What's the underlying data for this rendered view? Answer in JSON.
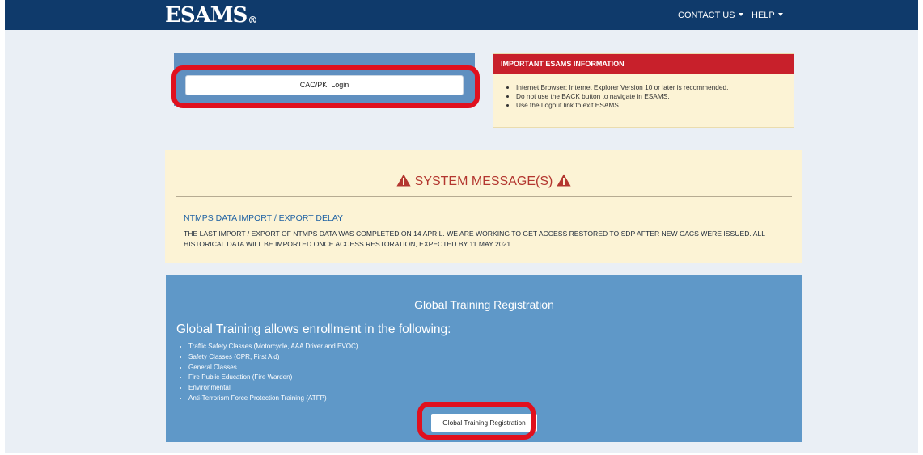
{
  "nav": {
    "logo": "ESAMS",
    "logo_mark": "®",
    "contact": "CONTACT US",
    "help": "HELP"
  },
  "login": {
    "button_label": "CAC/PKI Login"
  },
  "info": {
    "heading": "IMPORTANT ESAMS INFORMATION",
    "items": [
      "Internet Browser: Internet Explorer Version 10 or later is recommended.",
      "Do not use the BACK button to navigate in ESAMS.",
      "Use the Logout link to exit ESAMS."
    ]
  },
  "system": {
    "title": "SYSTEM MESSAGE(S)",
    "subtitle": "NTMPS DATA IMPORT / EXPORT DELAY",
    "body": "THE LAST IMPORT / EXPORT OF NTMPS DATA WAS COMPLETED ON 14 APRIL.  WE ARE WORKING TO GET ACCESS RESTORED TO SDP AFTER NEW CACS WERE ISSUED.  ALL HISTORICAL DATA WILL BE IMPORTED ONCE ACCESS RESTORATION, EXPECTED BY 11 MAY 2021."
  },
  "training": {
    "title": "Global Training Registration",
    "subtitle": "Global Training allows enrollment in the following:",
    "items": [
      "Traffic Safety Classes (Motorcycle, AAA Driver and EVOC)",
      "Safety Classes (CPR, First Aid)",
      "General Classes",
      "Fire Public Education (Fire Warden)",
      "Environmental",
      "Anti-Terrorism Force Protection Training (ATFP)"
    ],
    "button_label": "Global Training Registration"
  },
  "colors": {
    "navbar": "#0f3a6b",
    "panel_blue": "#5f98c8",
    "alert_red": "#c8202b",
    "note_yellow": "#fcf3d5",
    "highlight_ring": "#e0101e"
  }
}
